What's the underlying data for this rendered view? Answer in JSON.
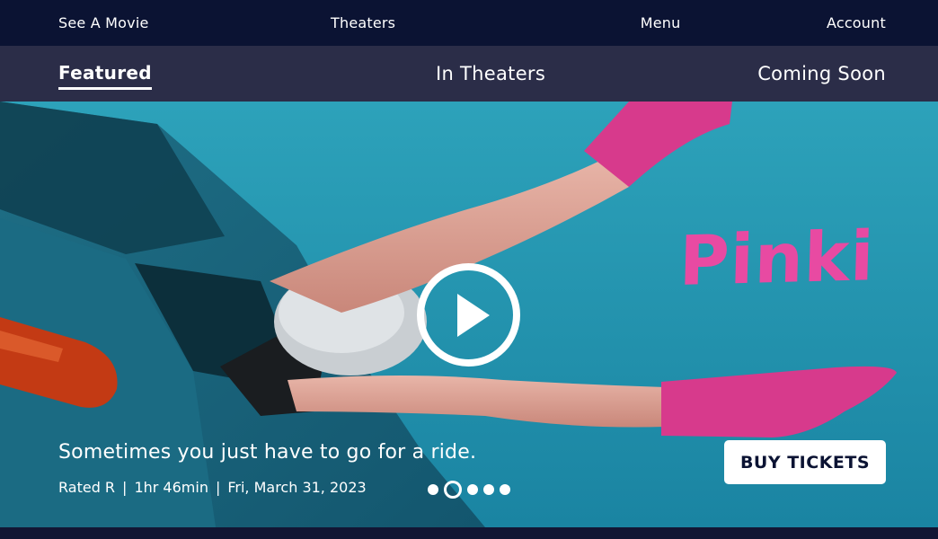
{
  "top_nav": {
    "items": [
      "See A Movie",
      "Theaters",
      "Menu",
      "Account"
    ]
  },
  "sub_nav": {
    "items": [
      "Featured",
      "In Theaters",
      "Coming Soon"
    ],
    "active": "Featured"
  },
  "hero": {
    "movie_title": "Pinki",
    "tagline": "Sometimes you just have to go for a ride.",
    "rating": "Rated R",
    "runtime": "1hr 46min",
    "release_date": "Fri, March 31, 2023",
    "separator": "|",
    "cta_label": "BUY TICKETS",
    "carousel": {
      "count": 5,
      "active_index": 1
    }
  },
  "colors": {
    "top_nav_bg": "#0b1333",
    "sub_nav_bg": "#2b2d48",
    "sky": "#1e8fab",
    "title_pink": "#e84aa2",
    "sock_pink": "#d73a8c",
    "button_text": "#0b1333"
  },
  "icons": {
    "play": "play-circle-icon"
  }
}
